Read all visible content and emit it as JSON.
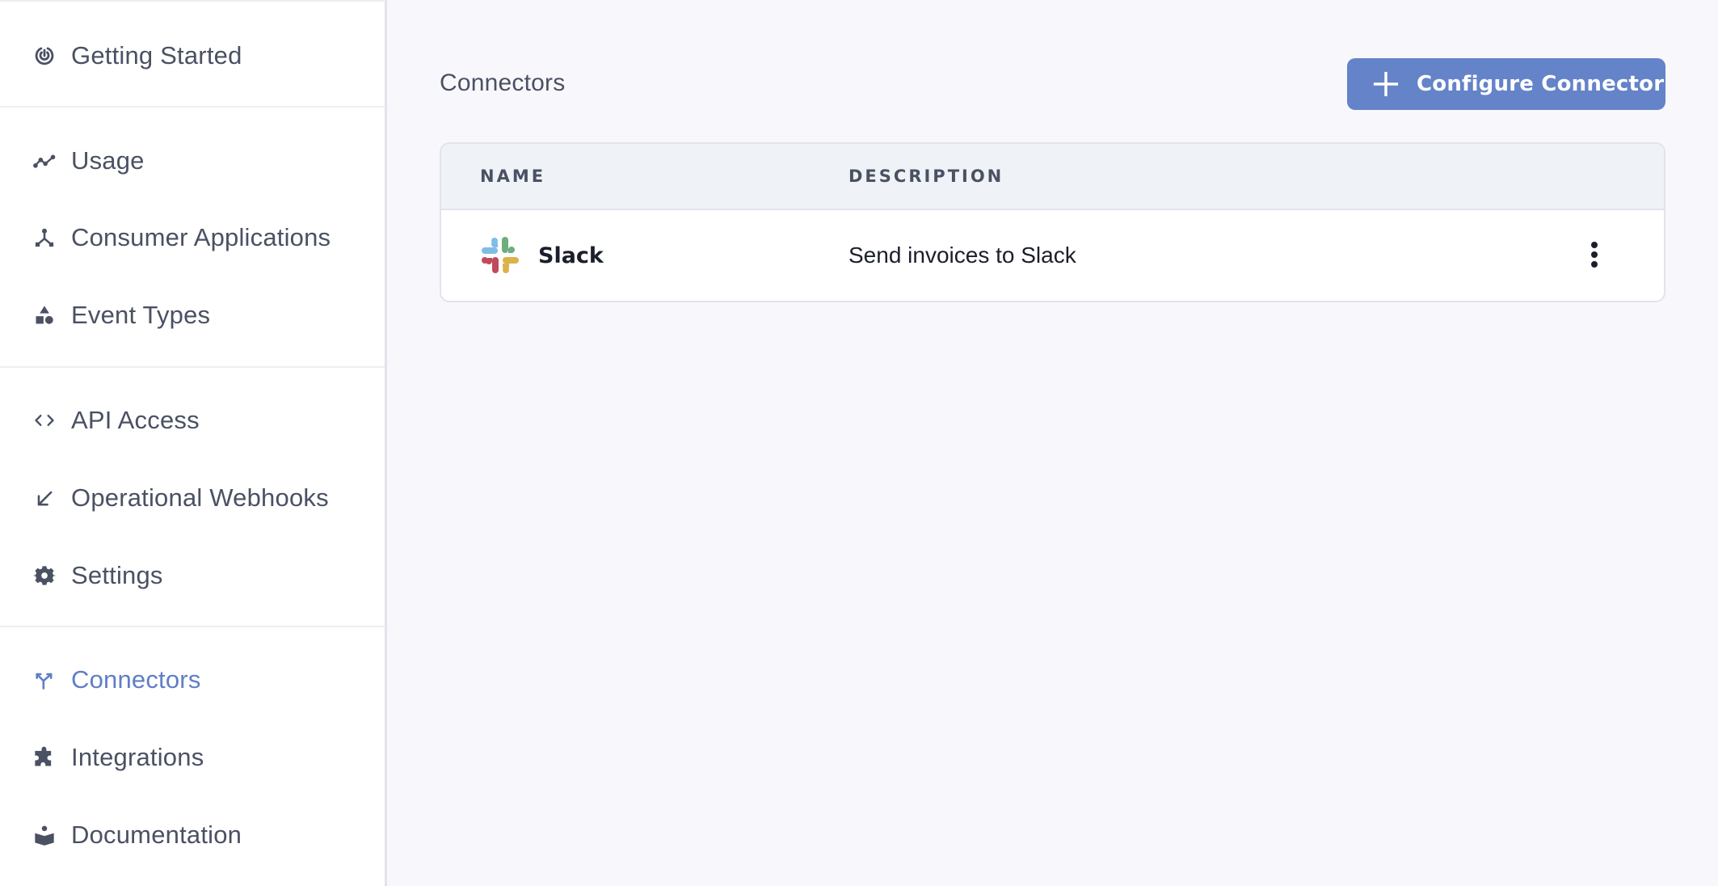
{
  "sidebar": {
    "items": [
      {
        "label": "Getting Started",
        "icon": "radar-icon",
        "active": false
      },
      {
        "label": "Usage",
        "icon": "line-chart-icon",
        "active": false
      },
      {
        "label": "Consumer Applications",
        "icon": "network-nodes-icon",
        "active": false
      },
      {
        "label": "Event Types",
        "icon": "shapes-icon",
        "active": false
      },
      {
        "label": "API Access",
        "icon": "code-brackets-icon",
        "active": false
      },
      {
        "label": "Operational Webhooks",
        "icon": "arrow-down-left-icon",
        "active": false
      },
      {
        "label": "Settings",
        "icon": "gear-icon",
        "active": false
      },
      {
        "label": "Connectors",
        "icon": "split-arrows-icon",
        "active": true
      },
      {
        "label": "Integrations",
        "icon": "puzzle-icon",
        "active": false
      },
      {
        "label": "Documentation",
        "icon": "book-reader-icon",
        "active": false
      }
    ]
  },
  "main": {
    "title": "Connectors",
    "configure_button_label": "Configure Connector",
    "table": {
      "columns": [
        "NAME",
        "DESCRIPTION"
      ],
      "rows": [
        {
          "name": "Slack",
          "description": "Send invoices to Slack",
          "icon": "slack-logo"
        }
      ]
    }
  },
  "colors": {
    "accent": "#6483c8",
    "active_nav": "#5f7ec6",
    "text": "#4a5163",
    "slack_blue": "#7fbde8",
    "slack_green": "#6cae7e",
    "slack_red": "#c04a5c",
    "slack_yellow": "#dcb34a"
  }
}
